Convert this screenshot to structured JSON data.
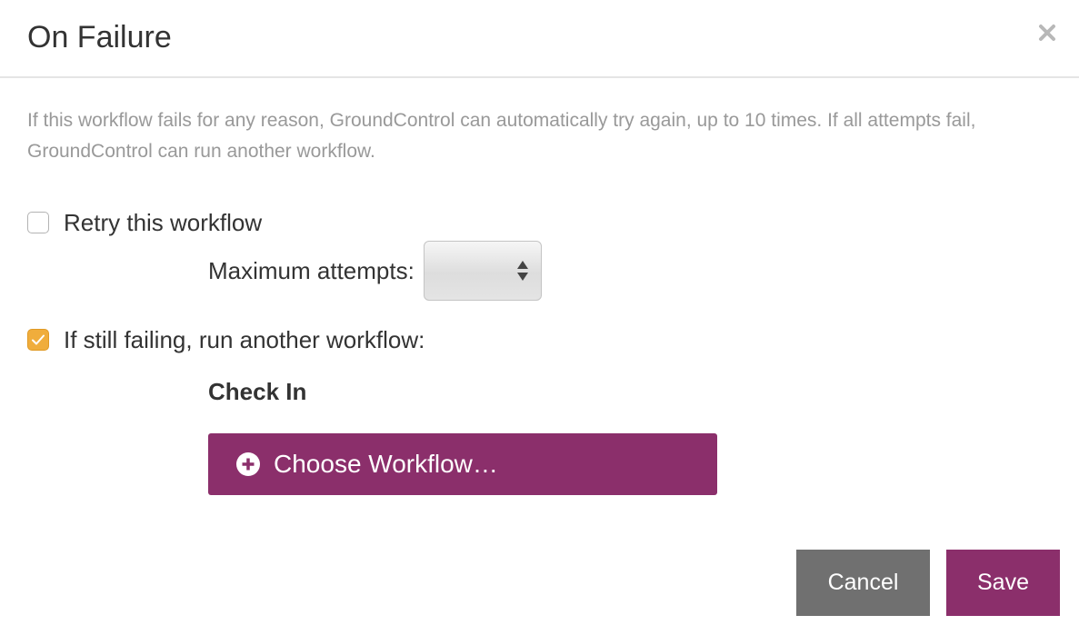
{
  "dialog": {
    "title": "On Failure",
    "close_icon": "close-icon",
    "description": "If this workflow fails for any reason, GroundControl can automatically try again, up to 10 times. If all attempts fail, GroundControl can run another workflow."
  },
  "retry": {
    "label": "Retry this workflow",
    "checked": false,
    "max_attempts_label": "Maximum attempts:",
    "max_attempts_value": ""
  },
  "fallback": {
    "label": "If still failing, run another workflow:",
    "checked": true,
    "workflow_name": "Check In",
    "choose_label": "Choose Workflow…",
    "choose_icon": "plus-circle-icon"
  },
  "footer": {
    "cancel_label": "Cancel",
    "save_label": "Save"
  },
  "colors": {
    "brand": "#8b2f6b",
    "checkbox_checked": "#f0ad3c",
    "cancel_bg": "#707070",
    "description_text": "#999999"
  }
}
